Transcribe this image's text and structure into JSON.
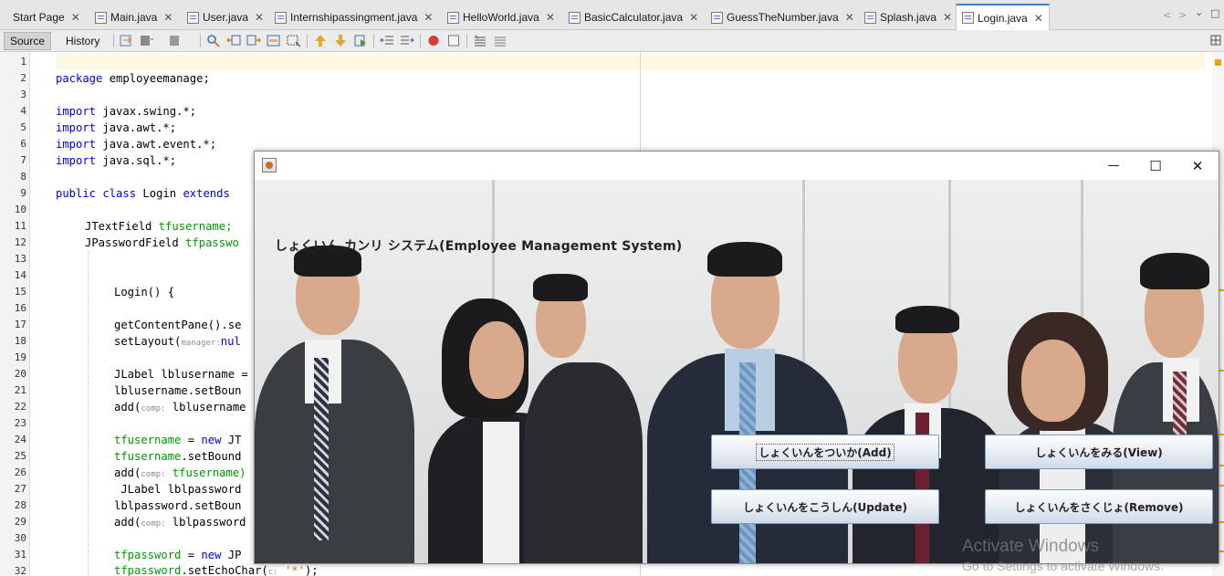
{
  "tabs": [
    {
      "label": "Start Page",
      "icon": "none"
    },
    {
      "label": "Main.java",
      "icon": "java-file-icon"
    },
    {
      "label": "User.java",
      "icon": "java-file-icon"
    },
    {
      "label": "Internshipassingment.java",
      "icon": "java-run-file-icon"
    },
    {
      "label": "HelloWorld.java",
      "icon": "java-run-file-icon"
    },
    {
      "label": "BasicCalculator.java",
      "icon": "java-run-file-icon"
    },
    {
      "label": "GuessTheNumber.java",
      "icon": "java-run-file-icon"
    },
    {
      "label": "Splash.java",
      "icon": "java-run-file-icon"
    },
    {
      "label": "Login.java",
      "icon": "java-run-file-icon",
      "active": true
    }
  ],
  "tab_close_glyph": "✕",
  "tab_nav": {
    "left": "<",
    "right": ">",
    "menu": "⌄",
    "restore": "□"
  },
  "toolbar": {
    "source_label": "Source",
    "history_label": "History"
  },
  "editor": {
    "line_numbers": [
      "1",
      "2",
      "3",
      "4",
      "5",
      "6",
      "7",
      "8",
      "9",
      "10",
      "11",
      "12",
      "13",
      "14",
      "15",
      "16",
      "17",
      "18",
      "19",
      "20",
      "21",
      "22",
      "23",
      "24",
      "25",
      "26",
      "27",
      "28",
      "29",
      "30",
      "31",
      "32"
    ],
    "lines": {
      "l2": "employeemanage;",
      "l4": "javax.swing.*;",
      "l5": "java.awt.*;",
      "l6": "java.awt.event.*;",
      "l7": "java.sql.*;",
      "l9_cls": "Login",
      "l11_type": "JTextField",
      "l11_name": "tfusername;",
      "l12_type": "JPasswordField",
      "l12_name": "tfpasswo",
      "l15": "Login() {",
      "l17": "getContentPane().se",
      "l18_a": "setLayout(",
      "l18_hint": "manager:",
      "l18_b": "nul",
      "l20": "JLabel lblusername =",
      "l21": "lblusername.setBoun",
      "l22_hint": "comp:",
      "l22_b": "lblusername",
      "l24_a": "tfusername",
      "l24_b": "= ",
      "l24_c": "JT",
      "l25_a": "tfusername",
      "l25_b": ".setBound",
      "l26_hint": "comp:",
      "l26_b": "tfusername)",
      "l27": " JLabel lblpassword",
      "l28": "lblpassword.setBoun",
      "l29_hint": "comp:",
      "l29_b": "lblpassword",
      "l31_a": "tfpassword",
      "l31_b": "= ",
      "l31_c": "JP",
      "l32_a": "tfpassword",
      "l32_b": ".setEchoChar(",
      "l32_hint": "c:",
      "l32_str": "'*'",
      "l32_end": ");"
    },
    "keywords": {
      "package": "package",
      "import": "import",
      "public": "public",
      "class": "class",
      "extends": "extends",
      "new": "new",
      "add": "add("
    }
  },
  "window": {
    "controls": {
      "minimize": "—",
      "maximize": "☐",
      "close": "✕"
    },
    "title": "しょくいん カンリ システム(Employee Management System)",
    "buttons": {
      "add": "しょくいんをついか(Add)",
      "view": "しょくいんをみる(View)",
      "update": "しょくいんをこうしん(Update)",
      "remove": "しょくいんをさくじょ(Remove)"
    }
  },
  "watermark": {
    "line1": "Activate Windows",
    "line2": "Go to Settings to activate Windows."
  },
  "colors": {
    "keyword": "#0000e6",
    "field": "#009900",
    "accent_tab": "#3c7fd1",
    "button_border": "#7d9ec0"
  }
}
